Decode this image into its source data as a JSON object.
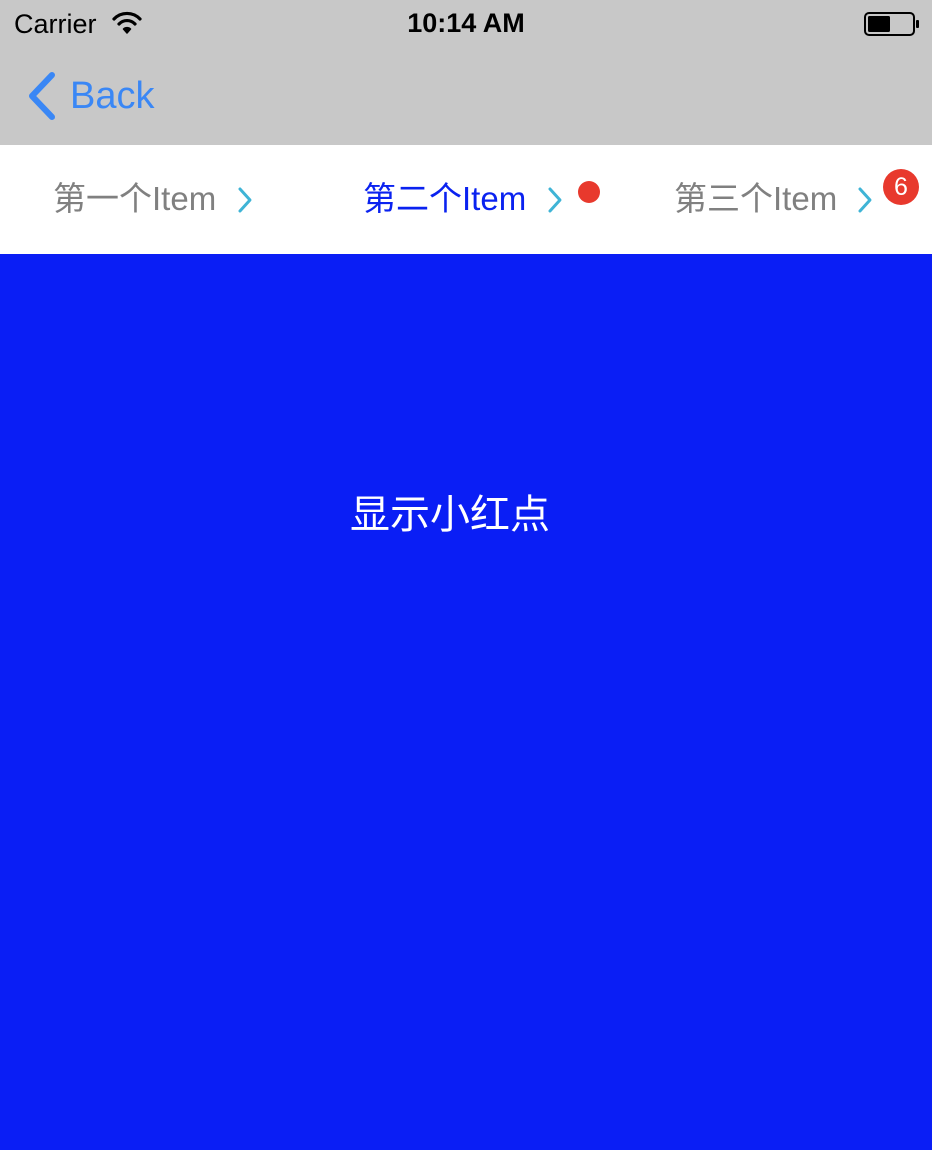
{
  "status_bar": {
    "carrier": "Carrier",
    "time": "10:14 AM",
    "wifi_icon": "wifi-icon",
    "battery_icon": "battery-icon"
  },
  "nav": {
    "back_label": "Back",
    "back_icon": "chevron-left-icon"
  },
  "tabs": [
    {
      "label": "第一个Item",
      "selected": false,
      "indicator": "none"
    },
    {
      "label": "第二个Item",
      "selected": true,
      "indicator": "dot"
    },
    {
      "label": "第三个Item",
      "selected": false,
      "indicator": "badge",
      "badge_count": "6"
    }
  ],
  "content": {
    "text": "显示小红点"
  },
  "colors": {
    "nav_background": "#c8c8c8",
    "back_tint": "#3a87f5",
    "tab_label_default": "#808080",
    "tab_label_selected": "#0a22f0",
    "tab_arrow": "#3fb4d6",
    "badge_red": "#e8392d",
    "content_background": "#0a1ef5",
    "content_text": "#ffffff"
  }
}
